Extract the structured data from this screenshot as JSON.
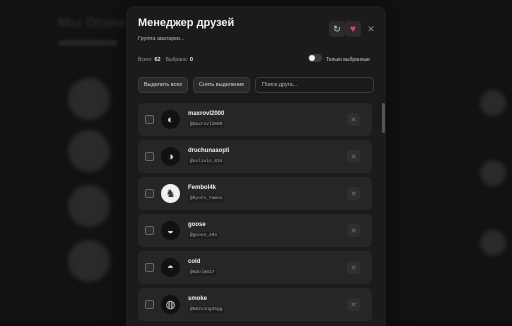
{
  "background": {
    "title": "Мы Oraneta"
  },
  "modal": {
    "title": "Менеджер друзей",
    "subtitle": "Группа аватарки...",
    "refresh_icon": "↻",
    "favorite_icon": "♥",
    "close_icon": "✕",
    "stats": {
      "total_label": "Всего:",
      "total_value": "62",
      "selected_label": "Выбрано:",
      "selected_value": "0"
    },
    "toggle_label": "Только выбранные",
    "select_all_label": "Выделить всех",
    "deselect_label": "Снять выделение",
    "search_placeholder": "Поиск друга...",
    "friends": [
      {
        "name": "maxrovl2000",
        "handle": "@maxrovl2000",
        "avatar_glyph": "◐",
        "light": false
      },
      {
        "name": "druchunasopli",
        "handle": "@nolivio_834",
        "avatar_glyph": "◑",
        "light": false
      },
      {
        "name": "Fembol4k",
        "handle": "@Kyoto_Yamno",
        "avatar_glyph": "♞",
        "light": true
      },
      {
        "name": "goose",
        "handle": "@goose_404",
        "avatar_glyph": "◒",
        "light": false
      },
      {
        "name": "cold",
        "handle": "@mdol8817",
        "avatar_glyph": "◓",
        "light": false
      },
      {
        "name": "smoke",
        "handle": "@m82x1ng35gg",
        "avatar_glyph": "◍",
        "light": false
      }
    ]
  },
  "colors": {
    "accent": "#e0455a",
    "panel": "#1b1b1b",
    "item": "#262626"
  }
}
